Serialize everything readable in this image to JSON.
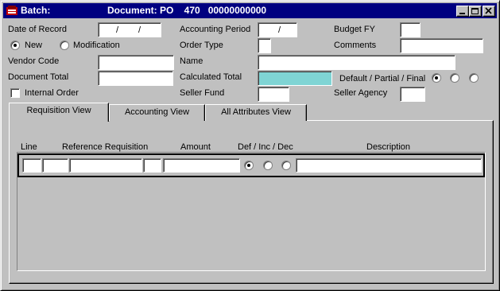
{
  "window": {
    "title_batch": "Batch:",
    "title_document": "Document: PO    470   00000000000"
  },
  "form": {
    "date_of_record_label": "Date of Record",
    "date_of_record_value": {
      "sep1": "/",
      "sep2": "/"
    },
    "accounting_period_label": "Accounting Period",
    "accounting_period_sep": "/",
    "budget_fy_label": "Budget FY",
    "new_label": "New",
    "modification_label": "Modification",
    "order_type_label": "Order Type",
    "comments_label": "Comments",
    "vendor_code_label": "Vendor Code",
    "name_label": "Name",
    "document_total_label": "Document Total",
    "calculated_total_label": "Calculated Total",
    "default_partial_final_label": "Default / Partial / Final",
    "internal_order_label": "Internal Order",
    "seller_fund_label": "Seller Fund",
    "seller_agency_label": "Seller Agency",
    "selected_mode": "New",
    "dpf_selected": "Default",
    "internal_order_checked": false
  },
  "tabs": [
    {
      "label": "Requisition View",
      "active": true
    },
    {
      "label": "Accounting View",
      "active": false
    },
    {
      "label": "All Attributes View",
      "active": false
    }
  ],
  "grid": {
    "columns": {
      "line": "Line",
      "reference_requisition": "Reference Requisition",
      "amount": "Amount",
      "def_inc_dec": "Def / Inc / Dec",
      "description": "Description"
    },
    "row_selected": "Def"
  },
  "colors": {
    "titlebar": "#000080",
    "face": "#c0c0c0",
    "calculated_total_bg": "#7fd4d4"
  }
}
